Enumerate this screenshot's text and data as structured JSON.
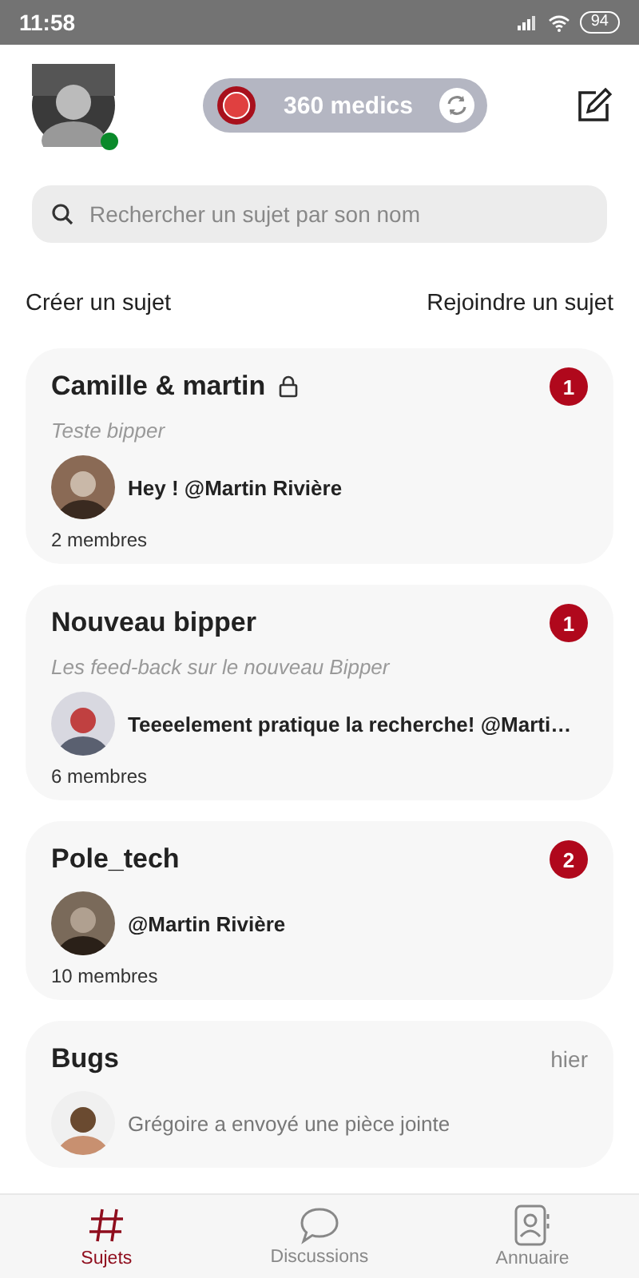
{
  "status_bar": {
    "time": "11:58",
    "battery": "94"
  },
  "header": {
    "workspace": "360 medics",
    "online": true
  },
  "search": {
    "placeholder": "Rechercher un sujet par son nom"
  },
  "actions": [
    "Créer un sujet",
    "Rejoindre un sujet"
  ],
  "topics": [
    {
      "title": "Camille & martin",
      "locked": true,
      "subtitle": "Teste bipper",
      "message": "Hey ! @Martin Rivière",
      "unread": true,
      "badge": "1",
      "members": "2 membres"
    },
    {
      "title": "Nouveau bipper",
      "locked": false,
      "subtitle": "Les feed-back sur le nouveau Bipper",
      "message": "Teeeelement pratique la recherche! @Marti…",
      "unread": true,
      "badge": "1",
      "members": "6 membres"
    },
    {
      "title": "Pole_tech",
      "locked": false,
      "message": "@Martin Rivière",
      "unread": true,
      "badge": "2",
      "members": "10 membres"
    },
    {
      "title": "Bugs",
      "locked": false,
      "time": "hier",
      "message": "Grégoire a envoyé une pièce jointe",
      "unread": false
    }
  ],
  "tabs": [
    {
      "label": "Sujets",
      "kind": "hash",
      "selected": true
    },
    {
      "label": "Discussions",
      "kind": "chat",
      "selected": false
    },
    {
      "label": "Annuaire",
      "kind": "contacts",
      "selected": false
    }
  ]
}
